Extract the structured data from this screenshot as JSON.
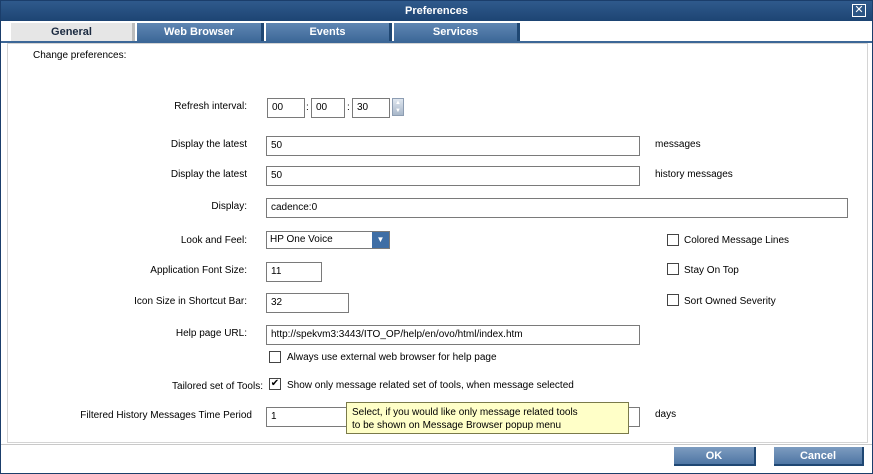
{
  "window": {
    "title": "Preferences",
    "close_glyph": "✕"
  },
  "tabs": [
    {
      "label": "General",
      "active": true
    },
    {
      "label": "Web Browser",
      "active": false
    },
    {
      "label": "Events",
      "active": false
    },
    {
      "label": "Services",
      "active": false
    }
  ],
  "panel": {
    "heading": "Change preferences:",
    "refresh": {
      "label": "Refresh interval:",
      "hours": "00",
      "minutes": "00",
      "seconds": "30"
    },
    "display_latest_messages": {
      "label": "Display the latest",
      "value": "50",
      "suffix": "messages"
    },
    "display_latest_history": {
      "label": "Display the latest",
      "value": "50",
      "suffix": "history messages"
    },
    "display": {
      "label": "Display:",
      "value": "cadence:0"
    },
    "look_and_feel": {
      "label": "Look and Feel:",
      "value": "HP One Voice"
    },
    "font_size": {
      "label": "Application Font Size:",
      "value": "11"
    },
    "icon_size": {
      "label": "Icon Size in Shortcut Bar:",
      "value": "32"
    },
    "help_url": {
      "label": "Help page URL:",
      "value": "http://spekvm3:3443/ITO_OP/help/en/ovo/html/index.htm"
    },
    "external_browser": {
      "label": "Always use external web browser for help page",
      "checked": false
    },
    "tailored_tools": {
      "label": "Tailored set of Tools:",
      "checkbox_label": "Show only message related set of tools, when message selected",
      "checked": true
    },
    "filtered_history": {
      "label": "Filtered History Messages Time Period",
      "value": "1",
      "suffix": "days"
    },
    "colored_lines": {
      "label": "Colored Message Lines",
      "checked": false
    },
    "stay_on_top": {
      "label": "Stay On Top",
      "checked": false
    },
    "sort_owned": {
      "label": "Sort Owned Severity",
      "checked": false
    },
    "tooltip": {
      "line1": "Select, if you would like only message related tools",
      "line2": "to be shown on Message Browser popup menu"
    }
  },
  "buttons": {
    "ok": "OK",
    "cancel": "Cancel"
  },
  "colors": {
    "title_bar": "#1d4473",
    "tab_inactive": "#3c6797",
    "tooltip_bg": "#ffffc8"
  }
}
